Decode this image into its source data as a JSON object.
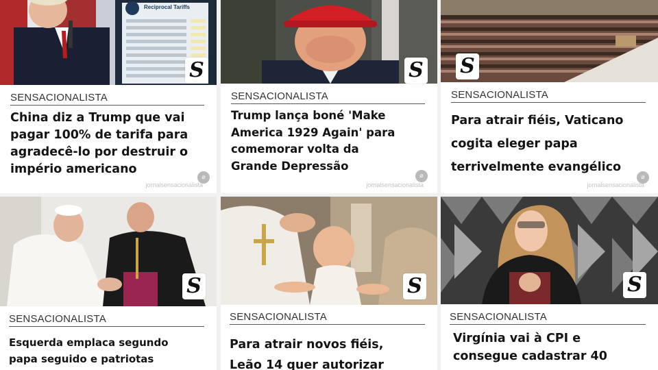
{
  "cards": [
    {
      "brand": "SENSACIONALISTA",
      "headline": "China diz a Trump que vai\npagar 100% de tarifa para\nagradecê-lo por destruir o\nimpério americano",
      "logo": "S",
      "credit": "jornalsensacionalista"
    },
    {
      "brand": "SENSACIONALISTA",
      "headline": "Trump lança boné 'Make\nAmerica 1929 Again' para\ncomemorar volta da\nGrande Depressão",
      "logo": "S",
      "credit": "jornalsensacionalista"
    },
    {
      "brand": "SENSACIONALISTA",
      "headline": "Para atrair fiéis, Vaticano\ncogita eleger papa\nterrivelmente evangélico",
      "logo": "S",
      "credit": "jornalsensacionalista"
    },
    {
      "brand": "SENSACIONALISTA",
      "headline": "Esquerda emplaca segundo\npapa seguido e patriotas",
      "logo": "S"
    },
    {
      "brand": "SENSACIONALISTA",
      "headline": "Para atrair novos fiéis,\nLeão 14 quer autorizar",
      "logo": "S"
    },
    {
      "brand": "SENSACIONALISTA",
      "headline": "Virgínia vai à CPI e\nconsegue cadastrar 40",
      "logo": "S"
    }
  ],
  "reciprocal_board": {
    "title": "Reciprocal Tariffs"
  }
}
